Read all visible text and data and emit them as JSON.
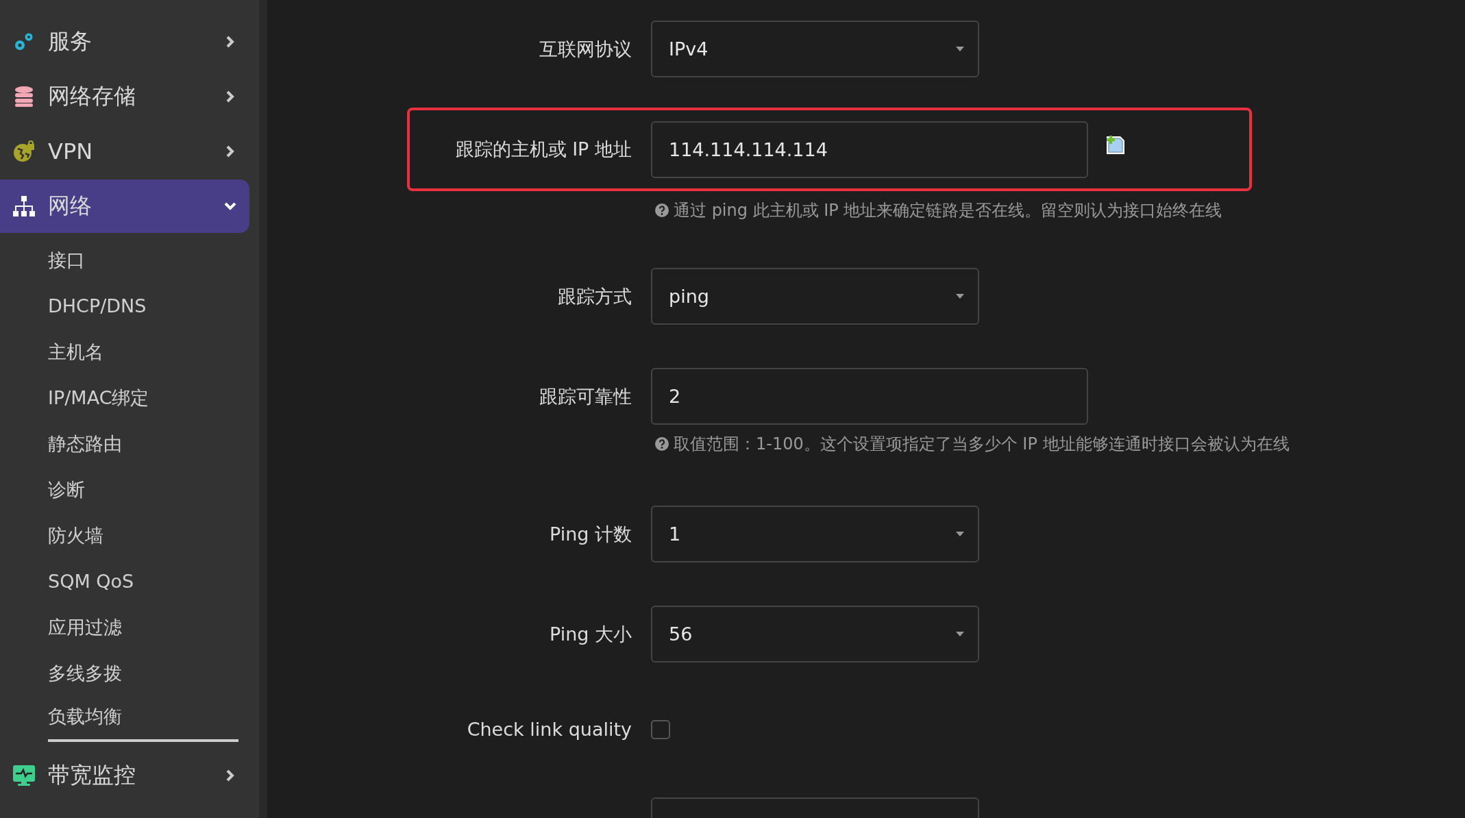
{
  "sidebar": {
    "items": [
      {
        "label": "服务",
        "expanded": false,
        "selected": false
      },
      {
        "label": "网络存储",
        "expanded": false,
        "selected": false
      },
      {
        "label": "VPN",
        "expanded": false,
        "selected": false
      },
      {
        "label": "网络",
        "expanded": true,
        "selected": true,
        "children": [
          {
            "label": "接口",
            "selected": false
          },
          {
            "label": "DHCP/DNS",
            "selected": false
          },
          {
            "label": "主机名",
            "selected": false
          },
          {
            "label": "IP/MAC绑定",
            "selected": false
          },
          {
            "label": "静态路由",
            "selected": false
          },
          {
            "label": "诊断",
            "selected": false
          },
          {
            "label": "防火墙",
            "selected": false
          },
          {
            "label": "SQM QoS",
            "selected": false
          },
          {
            "label": "应用过滤",
            "selected": false
          },
          {
            "label": "多线多拨",
            "selected": false
          },
          {
            "label": "负载均衡",
            "selected": true
          }
        ]
      },
      {
        "label": "带宽监控",
        "expanded": false,
        "selected": false
      }
    ]
  },
  "form": {
    "fields": [
      {
        "kind": "select",
        "label": "互联网协议",
        "value": "IPv4",
        "highlighted": false
      },
      {
        "kind": "text",
        "label": "跟踪的主机或 IP 地址",
        "value": "114.114.114.114",
        "highlighted": true,
        "add_button": true,
        "hint": "通过 ping 此主机或 IP 地址来确定链路是否在线。留空则认为接口始终在线"
      },
      {
        "kind": "select",
        "label": "跟踪方式",
        "value": "ping",
        "highlighted": false
      },
      {
        "kind": "text",
        "label": "跟踪可靠性",
        "value": "2",
        "highlighted": false,
        "hint": "取值范围：1-100。这个设置项指定了当多少个 IP 地址能够连通时接口会被认为在线"
      },
      {
        "kind": "select",
        "label": "Ping 计数",
        "value": "1",
        "highlighted": false
      },
      {
        "kind": "select",
        "label": "Ping 大小",
        "value": "56",
        "highlighted": false
      },
      {
        "kind": "checkbox",
        "label": "Check link quality",
        "checked": false,
        "highlighted": false
      },
      {
        "kind": "select",
        "highlighted": false
      }
    ]
  }
}
